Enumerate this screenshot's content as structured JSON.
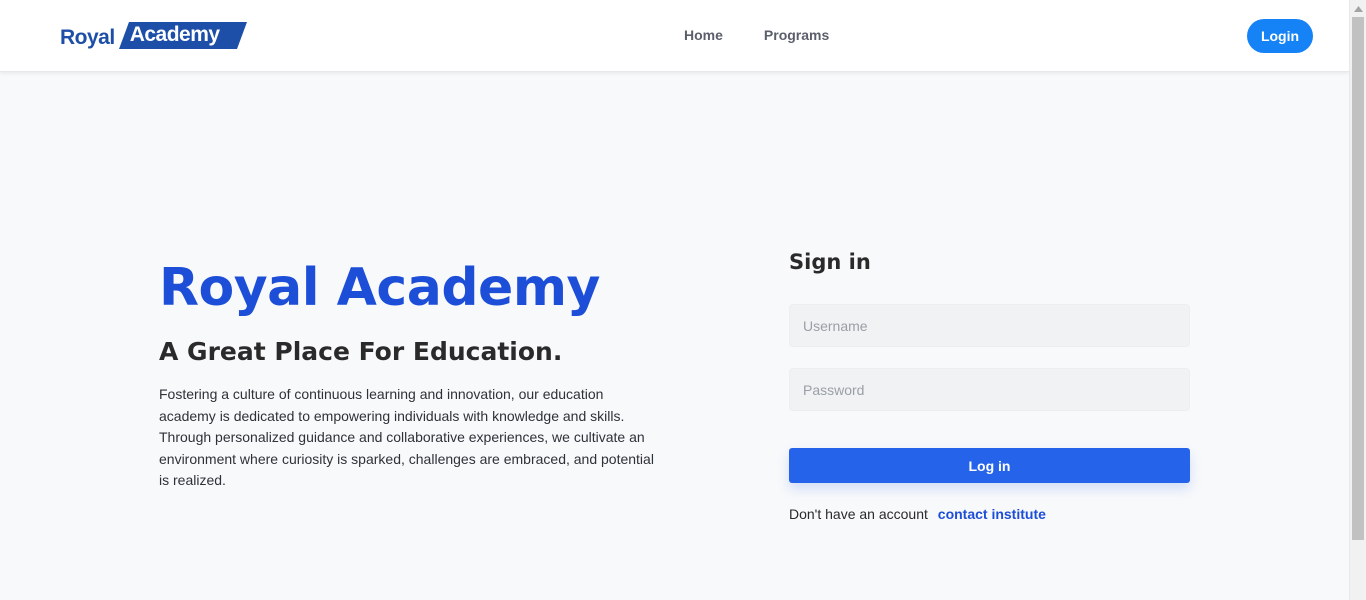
{
  "brand": {
    "logo_part1": "Royal",
    "logo_part2": "Academy",
    "logo_color": "#1e4fa8"
  },
  "nav": {
    "items": [
      {
        "label": "Home"
      },
      {
        "label": "Programs"
      }
    ],
    "login_label": "Login"
  },
  "hero": {
    "title": "Royal Academy",
    "subtitle": "A Great Place For Education.",
    "description": "Fostering a culture of continuous learning and innovation, our education academy is dedicated to empowering individuals with knowledge and skills. Through personalized guidance and collaborative experiences, we cultivate an environment where curiosity is sparked, challenges are embraced, and potential is realized."
  },
  "signin": {
    "title": "Sign in",
    "username_placeholder": "Username",
    "password_placeholder": "Password",
    "submit_label": "Log in",
    "no_account_text": "Don't have an account",
    "contact_link": "contact institute"
  },
  "colors": {
    "accent": "#2563eb",
    "title_blue": "#1d4ed8",
    "login_pill": "#1583f5"
  }
}
